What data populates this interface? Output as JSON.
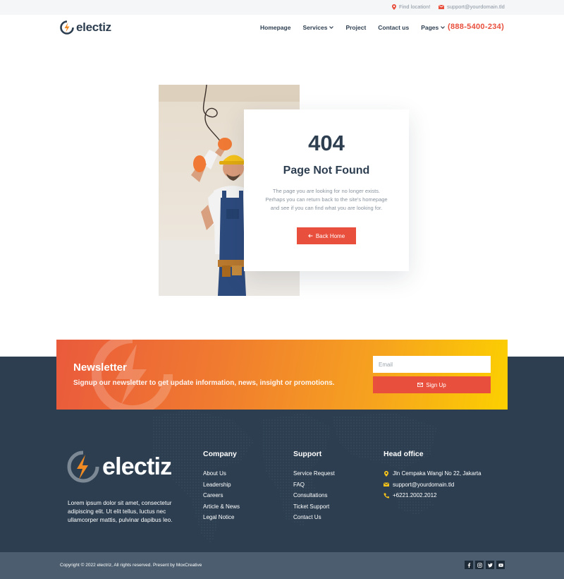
{
  "topbar": {
    "location": "Find location!",
    "email": "support@yourdomain.tld"
  },
  "header": {
    "brand": "electiz",
    "nav": [
      {
        "label": "Homepage",
        "dropdown": false
      },
      {
        "label": "Services",
        "dropdown": true
      },
      {
        "label": "Project",
        "dropdown": false
      },
      {
        "label": "Contact us",
        "dropdown": false
      },
      {
        "label": "Pages",
        "dropdown": true
      }
    ],
    "phone": "(888-5400-234)"
  },
  "error": {
    "code": "404",
    "title": "Page Not Found",
    "description": "The page you are looking for no longer exists. Perhaps you can return back to the site's homepage and see if you can find what you are looking for.",
    "button": "Back Home"
  },
  "newsletter": {
    "title": "Newsletter",
    "subtitle": "Signup our newsletter to get update information, news, insight or promotions.",
    "placeholder": "Email",
    "button": "Sign Up"
  },
  "footer": {
    "brand": "electiz",
    "about": "Lorem ipsum dolor sit amet, consectetur adipiscing elit. Ut elit tellus, luctus nec ullamcorper mattis, pulvinar dapibus leo.",
    "company": {
      "title": "Company",
      "links": [
        "About Us",
        "Leadership",
        "Careers",
        "Article & News",
        "Legal Notice"
      ]
    },
    "support": {
      "title": "Support",
      "links": [
        "Service Request",
        "FAQ",
        "Consultations",
        "Ticket Support",
        "Contact Us"
      ]
    },
    "office": {
      "title": "Head office",
      "address": "Jln Cempaka Wangi No 22, Jakarta",
      "email": "support@yourdomain.tld",
      "phone": "+6221.2002.2012"
    },
    "copyright": "Copyright © 2022 electriz, All rights reserved. Present by MoxCreative",
    "socials": [
      "facebook-icon",
      "instagram-icon",
      "twitter-icon",
      "youtube-icon"
    ]
  },
  "colors": {
    "accent": "#e94f3d",
    "navy": "#2c3e50",
    "gradient_end": "#fcd000"
  }
}
